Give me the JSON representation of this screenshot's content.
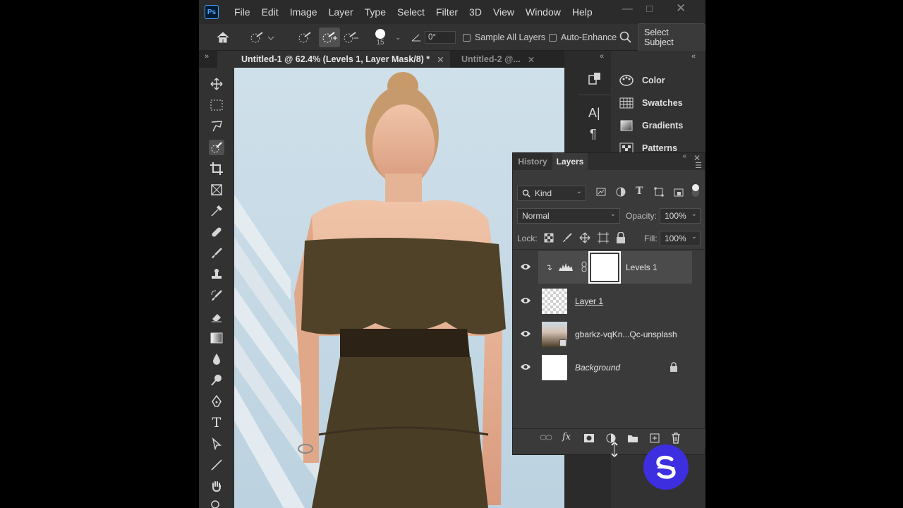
{
  "menubar": {
    "app_icon_label": "Ps",
    "items": [
      "File",
      "Edit",
      "Image",
      "Layer",
      "Type",
      "Select",
      "Filter",
      "3D",
      "View",
      "Window",
      "Help"
    ]
  },
  "options": {
    "brush_size": "15",
    "angle": "0°",
    "sample_all_layers": "Sample All Layers",
    "auto_enhance": "Auto-Enhance",
    "select_subject": "Select Subject"
  },
  "tabs": [
    {
      "label": "Untitled-1 @ 62.4% (Levels 1, Layer Mask/8) *",
      "active": true
    },
    {
      "label": "Untitled-2 @...",
      "active": false
    }
  ],
  "right_panel": {
    "items": [
      "Color",
      "Swatches",
      "Gradients",
      "Patterns"
    ]
  },
  "layers_panel": {
    "tabs": [
      "History",
      "Layers"
    ],
    "kind_label": "Kind",
    "blend_mode": "Normal",
    "opacity_label": "Opacity:",
    "opacity_value": "100%",
    "lock_label": "Lock:",
    "fill_label": "Fill:",
    "fill_value": "100%",
    "layers": [
      {
        "name": "Levels 1"
      },
      {
        "name": "Layer 1"
      },
      {
        "name": "gbarkz-vqKn...Qc-unsplash"
      },
      {
        "name": "Background"
      }
    ]
  },
  "colors": {
    "accent": "#4da3ff",
    "watermark": "#3d2ee0"
  }
}
